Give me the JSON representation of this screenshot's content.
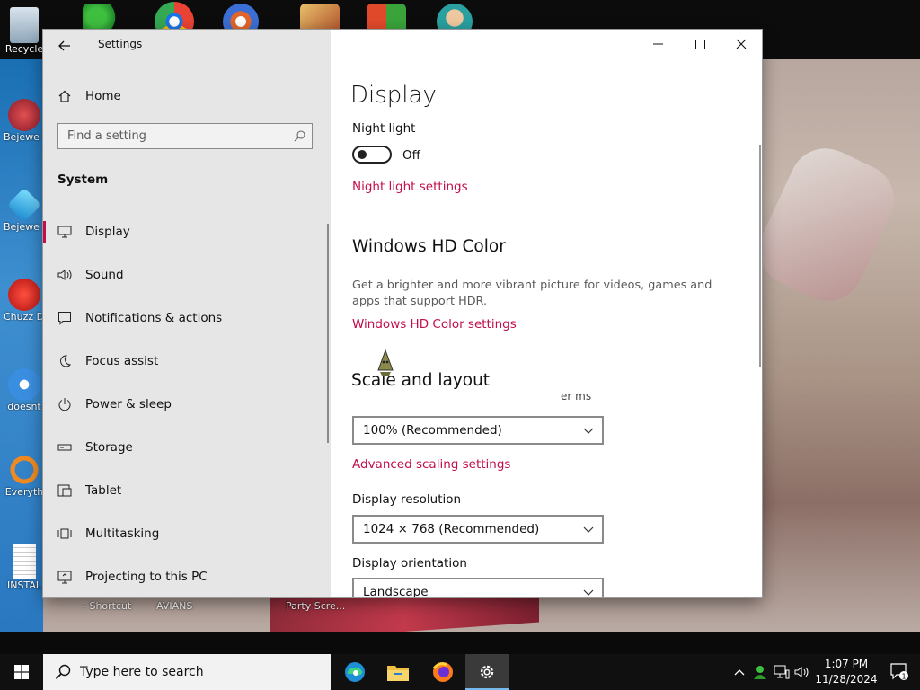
{
  "desktop": {
    "icons": [
      {
        "label": "Recycle"
      },
      {
        "label": "Bejewe Delux"
      },
      {
        "label": "Bejewe Delux"
      },
      {
        "label": "Chuzz Delux"
      },
      {
        "label": "doesnt"
      },
      {
        "label": "Everyth"
      },
      {
        "label": "INSTAL"
      }
    ],
    "bottom_labels": [
      "- Shortcut",
      "AVIANS",
      "Party Scre..."
    ]
  },
  "window": {
    "title": "Settings",
    "controls": {
      "minimize": "—",
      "maximize": "☐",
      "close": "✕"
    }
  },
  "nav": {
    "home_label": "Home",
    "search_placeholder": "Find a setting",
    "section_label": "System",
    "items": [
      {
        "label": "Display",
        "icon": "monitor-icon",
        "selected": true
      },
      {
        "label": "Sound",
        "icon": "speaker-icon"
      },
      {
        "label": "Notifications & actions",
        "icon": "notification-icon"
      },
      {
        "label": "Focus assist",
        "icon": "moon-icon"
      },
      {
        "label": "Power & sleep",
        "icon": "power-icon"
      },
      {
        "label": "Storage",
        "icon": "storage-icon"
      },
      {
        "label": "Tablet",
        "icon": "tablet-icon"
      },
      {
        "label": "Multitasking",
        "icon": "multitasking-icon"
      },
      {
        "label": "Projecting to this PC",
        "icon": "projecting-icon"
      }
    ]
  },
  "content": {
    "page_title": "Display",
    "night_light": {
      "label": "Night light",
      "state": "Off",
      "settings_link": "Night light settings"
    },
    "hd_color": {
      "heading": "Windows HD Color",
      "description": "Get a brighter and more vibrant picture for videos, games and apps that support HDR.",
      "settings_link": "Windows HD Color settings"
    },
    "scale": {
      "heading": "Scale and layout",
      "partial_text": "er    ms",
      "value": "100% (Recommended)",
      "advanced_link": "Advanced scaling settings"
    },
    "resolution": {
      "label": "Display resolution",
      "value": "1024 × 768 (Recommended)"
    },
    "orientation": {
      "label": "Display orientation",
      "value": "Landscape"
    }
  },
  "taskbar": {
    "search_placeholder": "Type here to search",
    "apps": [
      {
        "name": "edge-icon"
      },
      {
        "name": "file-explorer-icon"
      },
      {
        "name": "firefox-icon"
      },
      {
        "name": "settings-gear-icon",
        "active": true
      }
    ],
    "clock": {
      "time": "1:07 PM",
      "date": "11/28/2024"
    },
    "notification_count": "1"
  },
  "colors": {
    "accent_link": "#c40d4b",
    "nav_bg": "#e6e6e6",
    "taskbar_bg": "#101010"
  }
}
